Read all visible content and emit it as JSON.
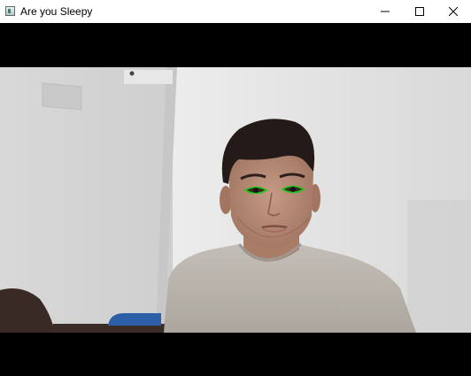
{
  "window": {
    "title": "Are you Sleepy",
    "app_icon": "app-window-icon",
    "controls": [
      "minimize-icon",
      "maximize-icon",
      "close-icon"
    ]
  },
  "camera": {
    "background_color": "#000000",
    "eye_outline_color": "#22c51a",
    "wall_color": "#d9d9d9",
    "shirt_color": "#b9b5ae",
    "hair_color": "#241b18"
  }
}
